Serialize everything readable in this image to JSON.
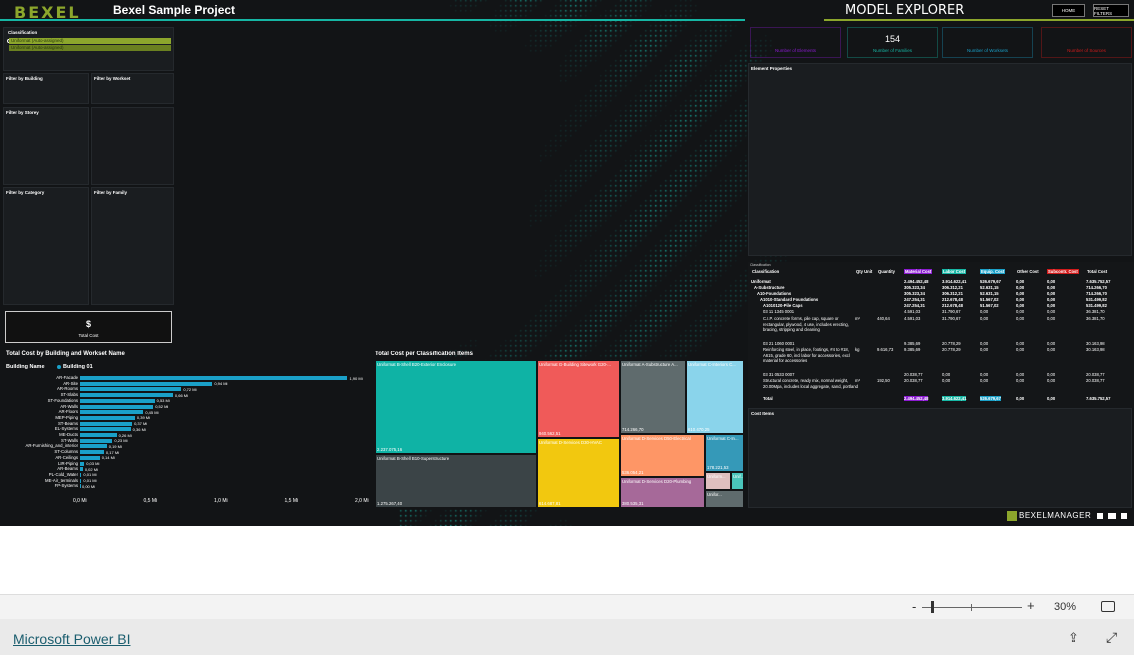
{
  "header": {
    "logo": "BEXEL",
    "project": "Bexel Sample Project",
    "explorer": "MODEL EXPLORER",
    "home": "HOME",
    "reset": "RESET FILTERS"
  },
  "classification": {
    "title": "Classification",
    "items": [
      "Uniformat (Auto-assigned)",
      "Uniformat (Auto-assigned)"
    ]
  },
  "filters": {
    "building": "Filter by Building",
    "workset": "Filter by Workset",
    "storey": "Filter by Storey",
    "category": "Filter by Category",
    "family": "Filter by Family"
  },
  "total_cost": {
    "value": "$",
    "label": "Total Cost"
  },
  "cards": [
    {
      "value": "",
      "label": "Number of Elements",
      "color": "#8b1bd1"
    },
    {
      "value": "154",
      "label": "Number of Families",
      "color": "#16b6a4"
    },
    {
      "value": "",
      "label": "Number of Worksets",
      "color": "#1aa0c8"
    },
    {
      "value": "",
      "label": "Number of Sources",
      "color": "#d11b1b"
    }
  ],
  "element_properties": "Element Properties",
  "cost_items": "Cost Items",
  "bar_chart": {
    "title": "Total Cost by Building and Workset Name",
    "legend_title": "Building Name",
    "legend_item": "Building 01",
    "legend_color": "#1aa0c8"
  },
  "treemap_title": "Total Cost per Classification Items",
  "table": {
    "headers": [
      "Classification",
      "Qty Unit",
      "Quantity",
      "Material Cost",
      "Labor Cost",
      "Equip. Cost",
      "Other Cost",
      "Subcontr. Cost",
      "Total Cost"
    ],
    "rows": [
      [
        "Uniformat",
        "",
        "",
        "2.494.452,48",
        "3.914.622,41",
        "526.679,67",
        "0,00",
        "0,00",
        "7.635.752,57"
      ],
      [
        "A-Substructure",
        "",
        "",
        "305.323,34",
        "306.312,21",
        "52.631,15",
        "0,00",
        "0,00",
        "714.266,70"
      ],
      [
        "A10-Foundations",
        "",
        "",
        "305.323,34",
        "306.312,21",
        "52.631,15",
        "0,00",
        "0,00",
        "714.266,70"
      ],
      [
        "A1010-Standard Foundations",
        "",
        "",
        "247.254,31",
        "212.678,48",
        "51.567,02",
        "0,00",
        "0,00",
        "531.499,82"
      ],
      [
        "A1010120-Pile Caps",
        "",
        "",
        "247.254,31",
        "212.678,48",
        "51.567,02",
        "0,00",
        "0,00",
        "531.499,82"
      ],
      [
        "03 11 1345 0001",
        "",
        "",
        "4.591,03",
        "31.790,67",
        "0,00",
        "0,00",
        "0,00",
        "36.381,70"
      ],
      [
        "C.I.P. concrete forms, pile cap, square or rectangular, plywood, 4 use, includes erecting, bracing, stripping and cleaning",
        "m²",
        "440,64",
        "4.591,03",
        "31.790,67",
        "0,00",
        "0,00",
        "0,00",
        "36.381,70"
      ],
      [
        "03 21 1060 0001",
        "",
        "",
        "9.385,69",
        "20.778,29",
        "0,00",
        "0,00",
        "0,00",
        "30.163,98"
      ],
      [
        "Reinforcing steel, in place, footings, #4 to #18, A615, grade 60, incl labor for accessories, excl material for accessories",
        "kg",
        "9.616,73",
        "9.385,69",
        "20.778,29",
        "0,00",
        "0,00",
        "0,00",
        "30.163,98"
      ],
      [
        "03 31 0533 0007",
        "",
        "",
        "20.038,77",
        "0,00",
        "0,00",
        "0,00",
        "0,00",
        "20.038,77"
      ],
      [
        "Structural concrete, ready mix, normal weight, 20.00Mpa, includes local aggregate, sand, portland",
        "m³",
        "192,50",
        "20.038,77",
        "0,00",
        "0,00",
        "0,00",
        "0,00",
        "20.038,77"
      ],
      [
        "Total",
        "",
        "",
        "2.494.452,48",
        "3.914.622,41",
        "526.679,67",
        "0,00",
        "0,00",
        "7.635.752,57"
      ]
    ]
  },
  "chart_data": [
    {
      "type": "bar",
      "title": "Total Cost by Building and Workset Name",
      "categories": [
        "AR-Facade",
        "AR-Site",
        "AR-Rooms",
        "ST-Slabs",
        "ST-Foundations",
        "AR-Walls",
        "AR-Floors",
        "MEP-Piping",
        "ST-Beams",
        "EL-Systems",
        "ME-Ducts",
        "ST-Walls",
        "AR-Furnishing_and_interior",
        "ST-Columns",
        "AR-Ceilings",
        "LIR-Piping",
        "AR-Beams",
        "PL-Cold_Water",
        "ME-Air_terminals",
        "FP-Systems"
      ],
      "values": [
        1.9,
        0.94,
        0.72,
        0.66,
        0.53,
        0.52,
        0.45,
        0.39,
        0.37,
        0.36,
        0.26,
        0.23,
        0.19,
        0.17,
        0.14,
        0.03,
        0.02,
        0.01,
        0.01,
        0.0
      ],
      "value_labels": [
        "1,90 Mi",
        "0,94 Mi",
        "0,72 Mi",
        "0,66 Mi",
        "0,53 Mi",
        "0,52 Mi",
        "0,45 Mi",
        "0,39 Mi",
        "0,37 Mi",
        "0,36 Mi",
        "0,26 Mi",
        "0,23 Mi",
        "0,19 Mi",
        "0,17 Mi",
        "0,14 Mi",
        "0,03 Mi",
        "0,02 Mi",
        "0,01 Mi",
        "0,01 Mi",
        "0,00 Mi"
      ],
      "xticks": [
        "0,0 Mi",
        "0,5 Mi",
        "1,0 Mi",
        "1,5 Mi",
        "2,0 Mi"
      ],
      "xlim": [
        0,
        2.0
      ],
      "series": [
        {
          "name": "Building 01"
        }
      ]
    },
    {
      "type": "treemap",
      "title": "Total Cost per Classification Items",
      "items": [
        {
          "name": "Uniformat B-Shell B20-Exterior Enclosure",
          "value": "2.237.075,16",
          "color": "#0fb3a5"
        },
        {
          "name": "Uniformat B-Shell B10-Superstructure",
          "value": "1.275.267,40",
          "color": "#3b4447"
        },
        {
          "name": "Uniformat G-Building Sitework G20-...",
          "value": "940.562,51",
          "color": "#f05a59"
        },
        {
          "name": "Uniformat D-Services D30-HVAC",
          "value": "614.687,81",
          "color": "#f2c80f"
        },
        {
          "name": "Uniformat A-Substructure A...",
          "value": "714.266,70",
          "color": "#5f6b6d"
        },
        {
          "name": "Uniformat C-Interiors C...",
          "value": "610.470,25",
          "color": "#8ad4eb"
        },
        {
          "name": "Uniformat D-Services D50-Electrical",
          "value": "536.054,21",
          "color": "#fe9666"
        },
        {
          "name": "Uniformat D-Services D20-Plumbing",
          "value": "380.535,31",
          "color": "#a66999"
        },
        {
          "name": "Uniformat C-In...",
          "value": "178.221,53",
          "color": "#3599b8"
        },
        {
          "name": "Uniform...",
          "value": "",
          "color": "#dfbfbf"
        },
        {
          "name": "Unif...",
          "value": "",
          "color": "#4ac5bb"
        },
        {
          "name": "Unifor...",
          "value": "",
          "color": "#5f6b6d"
        }
      ]
    }
  ],
  "powerbi": {
    "zoom": "30%",
    "link": "Microsoft Power BI",
    "brand": "BEXELMANAGER"
  }
}
